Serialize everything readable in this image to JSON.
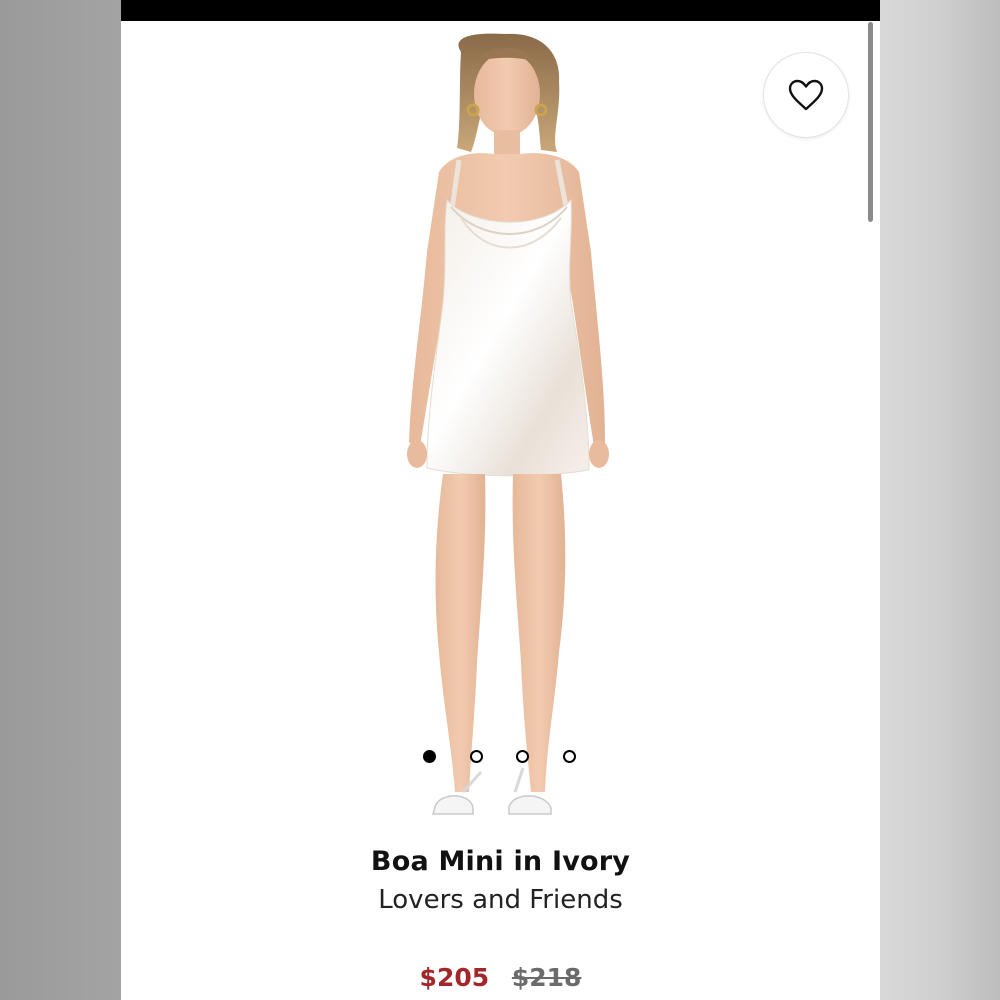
{
  "product": {
    "title": "Boa Mini in Ivory",
    "brand": "Lovers and Friends",
    "sale_price": "$205",
    "original_price": "$218"
  },
  "gallery": {
    "image_count": 4,
    "active_index": 0
  },
  "icons": {
    "favorite": "heart-outline-icon"
  },
  "colors": {
    "sale_price": "#a3262a",
    "original_price": "#6b6b6b",
    "status_bar": "#000000",
    "dot_active": "#000000"
  }
}
